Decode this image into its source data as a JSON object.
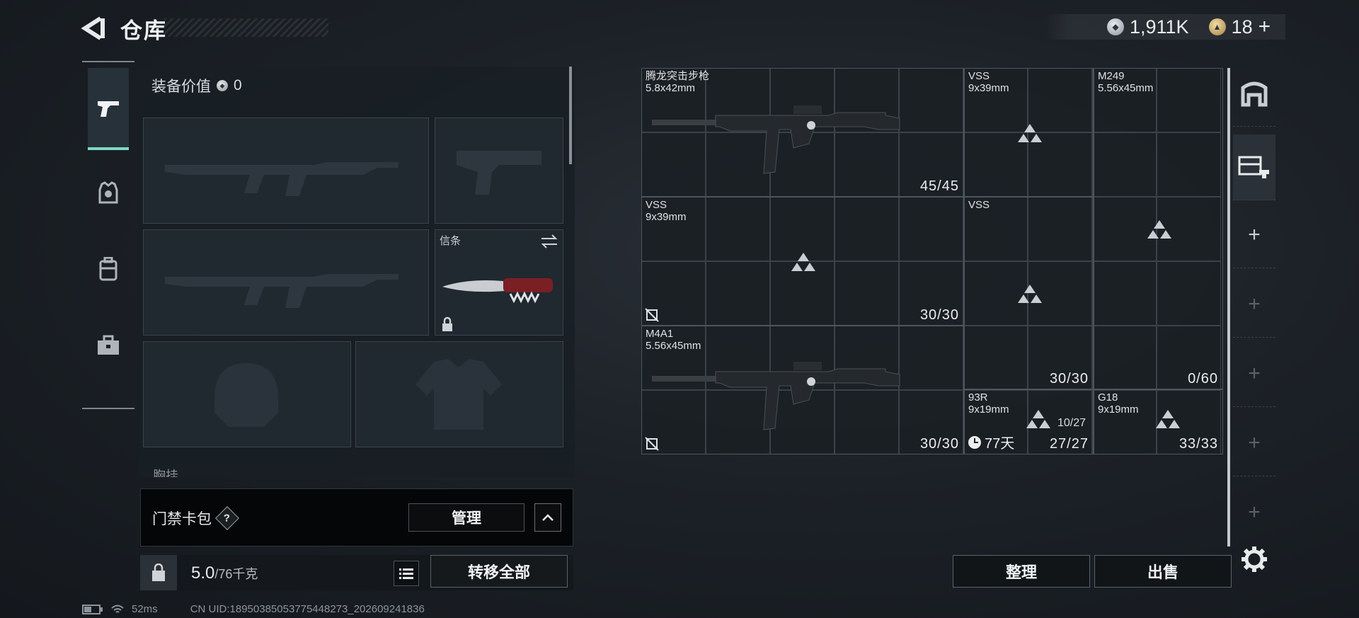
{
  "header": {
    "title": "仓库",
    "currency": {
      "silver_value": "1,911K",
      "gold_value": "18",
      "plus": "+"
    }
  },
  "left_nav": [
    "weapons-tab",
    "armor-tab",
    "backpack-tab",
    "supplies-tab"
  ],
  "equipment": {
    "value_label": "装备价值",
    "value_amount": "0",
    "melee_label": "信条",
    "partial_label": "胸挂"
  },
  "card_pack": {
    "title": "门禁卡包",
    "help": "?",
    "manage_label": "管理"
  },
  "weight": {
    "current": "5.0",
    "capacity": "/76千克",
    "transfer_label": "转移全部"
  },
  "status_bar": {
    "ping": "52ms",
    "uid": "CN UID:18950385053775448273_202609241836"
  },
  "stash": {
    "items": [
      {
        "name": "腾龙突击步枪",
        "ammo": "5.8x42mm",
        "qty": "45/45"
      },
      {
        "name": "VSS",
        "ammo": "9x39mm",
        "qty": ""
      },
      {
        "name": "M249",
        "ammo": "5.56x45mm",
        "qty": "0/60"
      },
      {
        "name": "VSS",
        "ammo": "9x39mm",
        "qty": "30/30"
      },
      {
        "name": "M4A1",
        "ammo": "5.56x45mm",
        "qty": "30/30"
      },
      {
        "name": "VSS",
        "ammo": "",
        "qty": "30/30"
      },
      {
        "name": "93R",
        "ammo": "9x19mm",
        "qty": "27/27",
        "sub_qty": "10/27",
        "timer": "77天"
      },
      {
        "name": "G18",
        "ammo": "9x19mm",
        "qty": "33/33"
      }
    ],
    "sort_label": "整理",
    "sell_label": "出售"
  },
  "colors": {
    "accent": "#7fd9c6",
    "bg": "#1c2127"
  }
}
